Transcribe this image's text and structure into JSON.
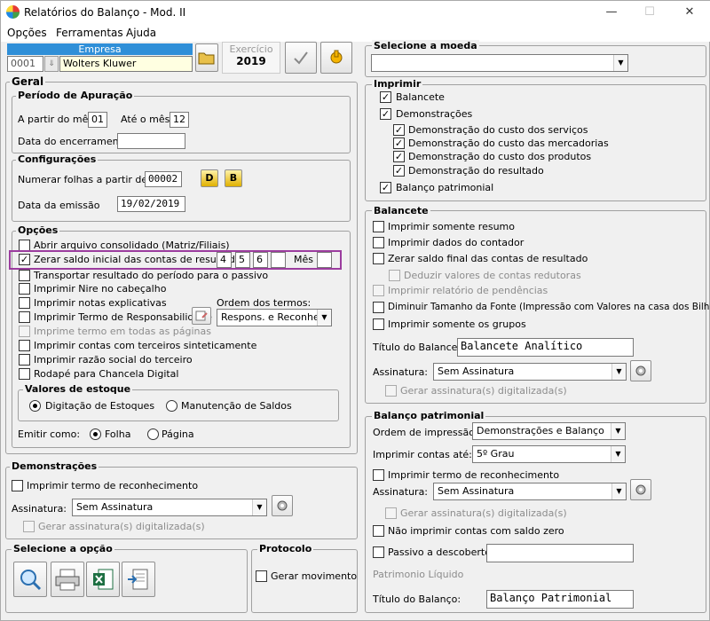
{
  "window": {
    "title": "Relatórios do Balanço - Mod. II",
    "minimize": "—",
    "maximize": "☐",
    "close": "✕"
  },
  "menu": {
    "opcoes": "Opções",
    "ferramentas": "Ferramentas",
    "ajuda": "Ajuda"
  },
  "empresa": {
    "header": "Empresa",
    "code": "0001",
    "name": "Wolters Kluwer",
    "exercicio_label": "Exercício",
    "exercicio_value": "2019"
  },
  "geral": {
    "title": "Geral",
    "periodo": {
      "title": "Período de Apuração",
      "from_label": "A partir do mês",
      "from_value": "01",
      "to_label": "Até o mês",
      "to_value": "12",
      "encerramento_label": "Data do encerramento",
      "encerramento_value": ""
    },
    "config": {
      "title": "Configurações",
      "folhas_label": "Numerar folhas a partir de",
      "folhas_value": "00002",
      "btn_d": "D",
      "btn_b": "B",
      "emissao_label": "Data da emissão",
      "emissao_value": "19/02/2019"
    },
    "opcoes": {
      "title": "Opções",
      "abrir_consolidado": "Abrir arquivo consolidado (Matriz/Filiais)",
      "zerar_saldo": "Zerar saldo inicial das contas de resultado",
      "zerar_a": "4",
      "zerar_b": "5",
      "zerar_c": "6",
      "zerar_d": "",
      "mes_label": "Mês",
      "transportar": "Transportar resultado do período para o passivo",
      "nire": "Imprimir Nire no cabeçalho",
      "notas": "Imprimir notas explicativas",
      "termo_resp": "Imprimir Termo de Responsabilidade",
      "ordem_label": "Ordem dos termos:",
      "ordem_value": "Respons. e Reconhec.",
      "imprime_termo_todas": "Imprime termo em todas as páginas",
      "contas_terceiros": "Imprimir contas com terceiros sinteticamente",
      "razao_social": "Imprimir razão social do terceiro",
      "rodape": "Rodapé para Chancela Digital",
      "valores_title": "Valores de estoque",
      "digitacao": "Digitação de Estoques",
      "manutencao": "Manutenção de Saldos",
      "emitir_label": "Emitir como:",
      "folha": "Folha",
      "pagina": "Página"
    }
  },
  "demonstracoes": {
    "title": "Demonstrações",
    "imprimir_termo": "Imprimir termo de reconhecimento",
    "assinatura_label": "Assinatura:",
    "assinatura_value": "Sem Assinatura",
    "gerar_assinatura": "Gerar assinatura(s) digitalizada(s)"
  },
  "selecione_opcao": {
    "title": "Selecione a opção"
  },
  "protocolo": {
    "title": "Protocolo",
    "gerar_movimento": "Gerar movimento"
  },
  "moeda": {
    "title": "Selecione a moeda",
    "value": ""
  },
  "imprimir": {
    "title": "Imprimir",
    "balancete": "Balancete",
    "demonstracoes": "Demonstrações",
    "custo_servicos": "Demonstração do custo dos serviços",
    "custo_mercadorias": "Demonstração do custo das mercadorias",
    "custo_produtos": "Demonstração do custo dos produtos",
    "resultado": "Demonstração do resultado",
    "balanco_patrimonial": "Balanço patrimonial"
  },
  "balancete": {
    "title": "Balancete",
    "somente_resumo": "Imprimir somente resumo",
    "dados_contador": "Imprimir dados do contador",
    "zerar_saldo_final": "Zerar saldo final das contas de resultado",
    "deduzir": "Deduzir valores de contas redutoras",
    "pendencias": "Imprimir relatório de pendências",
    "diminuir_fonte": "Diminuir Tamanho da Fonte (Impressão com Valores na casa dos Bilhões)",
    "somente_grupos": "Imprimir somente os grupos",
    "titulo_label": "Título do Balancete:",
    "titulo_value": "Balancete Analítico",
    "assinatura_label": "Assinatura:",
    "assinatura_value": "Sem Assinatura",
    "gerar_assinatura": "Gerar assinatura(s) digitalizada(s)"
  },
  "balanco": {
    "title": "Balanço patrimonial",
    "ordem_label": "Ordem de impressão:",
    "ordem_value": "Demonstrações e Balanço",
    "contas_ate_label": "Imprimir contas até:",
    "contas_ate_value": "5º Grau",
    "imprimir_termo": "Imprimir termo de reconhecimento",
    "assinatura_label": "Assinatura:",
    "assinatura_value": "Sem Assinatura",
    "gerar_assinatura": "Gerar assinatura(s) digitalizada(s)",
    "nao_imprimir_zero": "Não imprimir contas com saldo zero",
    "passivo_descoberto": "Passivo a descoberto",
    "passivo_value": "",
    "patrimonio_label": "Patrimonio Líquido",
    "titulo_label": "Título do Balanço:",
    "titulo_value": "Balanço Patrimonial"
  },
  "colors": {
    "accent": "#2f8fd8",
    "highlight": "#9b3c9e",
    "empresa_field": "#ffffe1"
  }
}
